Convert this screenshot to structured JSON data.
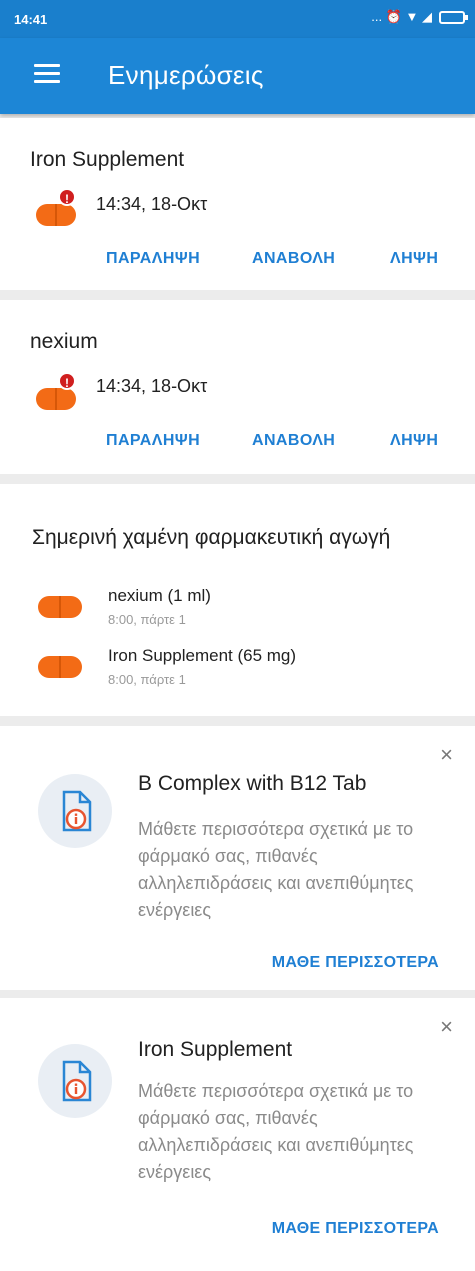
{
  "status_bar": {
    "time": "14:41",
    "icons_text": "... ⏰ ▼ ◢"
  },
  "app_bar": {
    "title": "Ενημερώσεις"
  },
  "alerts": [
    {
      "name": "Iron Supplement",
      "time": "14:34, 18-Οκτ",
      "badge": "!",
      "actions": {
        "skip": "ΠΑΡΑΛΗΨΗ",
        "snooze": "ΑΝΑΒΟΛΗ",
        "take": "ΛΗΨΗ"
      }
    },
    {
      "name": "nexium",
      "time": "14:34, 18-Οκτ",
      "badge": "!",
      "actions": {
        "skip": "ΠΑΡΑΛΗΨΗ",
        "snooze": "ΑΝΑΒΟΛΗ",
        "take": "ΛΗΨΗ"
      }
    }
  ],
  "missed": {
    "title": "Σημερινή χαμένη φαρμακευτική αγωγή",
    "items": [
      {
        "name": "nexium (1 ml)",
        "sub": "8:00, πάρτε 1"
      },
      {
        "name": "Iron Supplement (65 mg)",
        "sub": "8:00, πάρτε 1"
      }
    ]
  },
  "info_cards": [
    {
      "title": "B Complex with B12 Tab",
      "body": "Μάθετε περισσότερα σχετικά με το φάρμακό σας, πιθανές αλληλεπιδράσεις και ανεπιθύμητες ενέργειες",
      "link": "ΜΑΘΕ ΠΕΡΙΣΣΟΤΕΡΑ",
      "close": "×"
    },
    {
      "title": "Iron Supplement",
      "body": "Μάθετε περισσότερα σχετικά με το φάρμακό σας, πιθανές αλληλεπιδράσεις και ανεπιθύμητες ενέργειες",
      "link": "ΜΑΘΕ ΠΕΡΙΣΣΟΤΕΡΑ",
      "close": "×"
    }
  ],
  "colors": {
    "primary": "#1d86d6",
    "accent": "#1f7fd3",
    "pill": "#f36b16",
    "badge": "#d01f1f"
  }
}
